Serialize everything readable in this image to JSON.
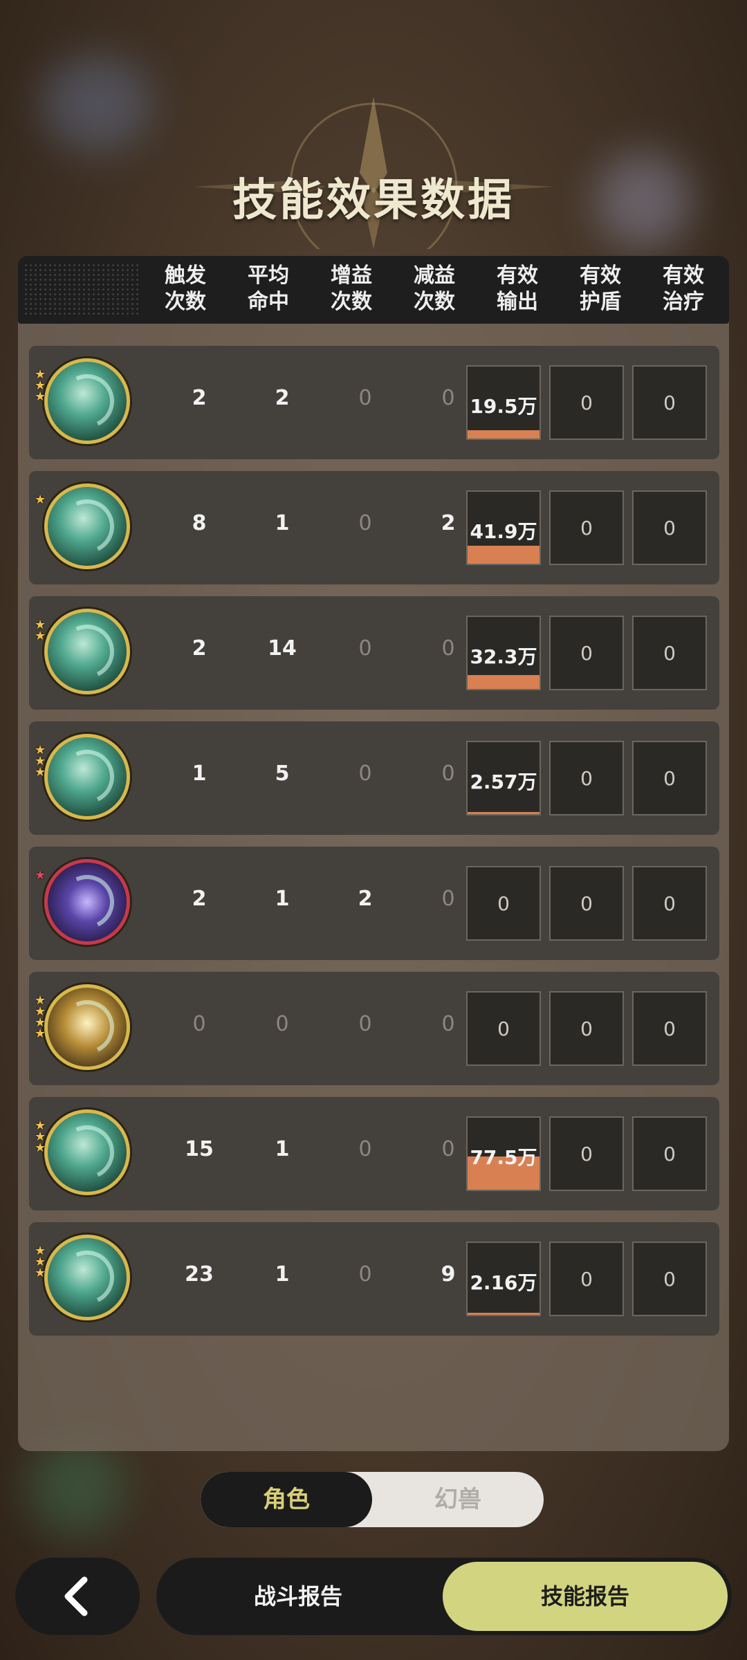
{
  "title": "技能效果数据",
  "columns": [
    "触发\n次数",
    "平均\n命中",
    "增益\n次数",
    "减益\n次数",
    "有效\n输出",
    "有效\n护盾",
    "有效\n治疗"
  ],
  "rows": [
    {
      "icon": "swirl-skill-icon",
      "stars": 3,
      "star_color": "gold",
      "trigger": "2",
      "avg_hit": "2",
      "buff": "0",
      "debuff": "0",
      "output": "19.5万",
      "output_ratio": 0.25,
      "shield": "0",
      "heal": "0"
    },
    {
      "icon": "wind-vortex-skill-icon",
      "stars": 1,
      "star_color": "gold",
      "trigger": "8",
      "avg_hit": "1",
      "buff": "0",
      "debuff": "2",
      "output": "41.9万",
      "output_ratio": 0.54,
      "shield": "0",
      "heal": "0"
    },
    {
      "icon": "leaf-slash-skill-icon",
      "stars": 2,
      "star_color": "gold",
      "trigger": "2",
      "avg_hit": "14",
      "buff": "0",
      "debuff": "0",
      "output": "32.3万",
      "output_ratio": 0.42,
      "shield": "0",
      "heal": "0"
    },
    {
      "icon": "wind-orb-skill-icon",
      "stars": 3,
      "star_color": "gold",
      "trigger": "1",
      "avg_hit": "5",
      "buff": "0",
      "debuff": "0",
      "output": "2.57万",
      "output_ratio": 0.03,
      "shield": "0",
      "heal": "0"
    },
    {
      "icon": "arcane-clock-skill-icon",
      "stars": 1,
      "star_color": "red",
      "trigger": "2",
      "avg_hit": "1",
      "buff": "2",
      "debuff": "0",
      "output": "0",
      "output_ratio": 0,
      "shield": "0",
      "heal": "0"
    },
    {
      "icon": "golden-arrows-skill-icon",
      "stars": 4,
      "star_color": "gold",
      "trigger": "0",
      "avg_hit": "0",
      "buff": "0",
      "debuff": "0",
      "output": "0",
      "output_ratio": 0,
      "shield": "0",
      "heal": "0"
    },
    {
      "icon": "jade-cloud-skill-icon",
      "stars": 3,
      "star_color": "gold",
      "trigger": "15",
      "avg_hit": "1",
      "buff": "0",
      "debuff": "0",
      "output": "77.5万",
      "output_ratio": 1.0,
      "shield": "0",
      "heal": "0"
    },
    {
      "icon": "ice-shards-skill-icon",
      "stars": 3,
      "star_color": "gold",
      "trigger": "23",
      "avg_hit": "1",
      "buff": "0",
      "debuff": "9",
      "output": "2.16万",
      "output_ratio": 0.03,
      "shield": "0",
      "heal": "0"
    }
  ],
  "toggle": {
    "active": "角色",
    "inactive": "幻兽"
  },
  "bottom": {
    "battle_report": "战斗报告",
    "skill_report": "技能报告",
    "back_icon": "chevron-left-icon"
  },
  "colors": {
    "output_bar": "#d88052",
    "active_tab": "#d2d480",
    "active_toggle_text": "#d8cf78"
  }
}
